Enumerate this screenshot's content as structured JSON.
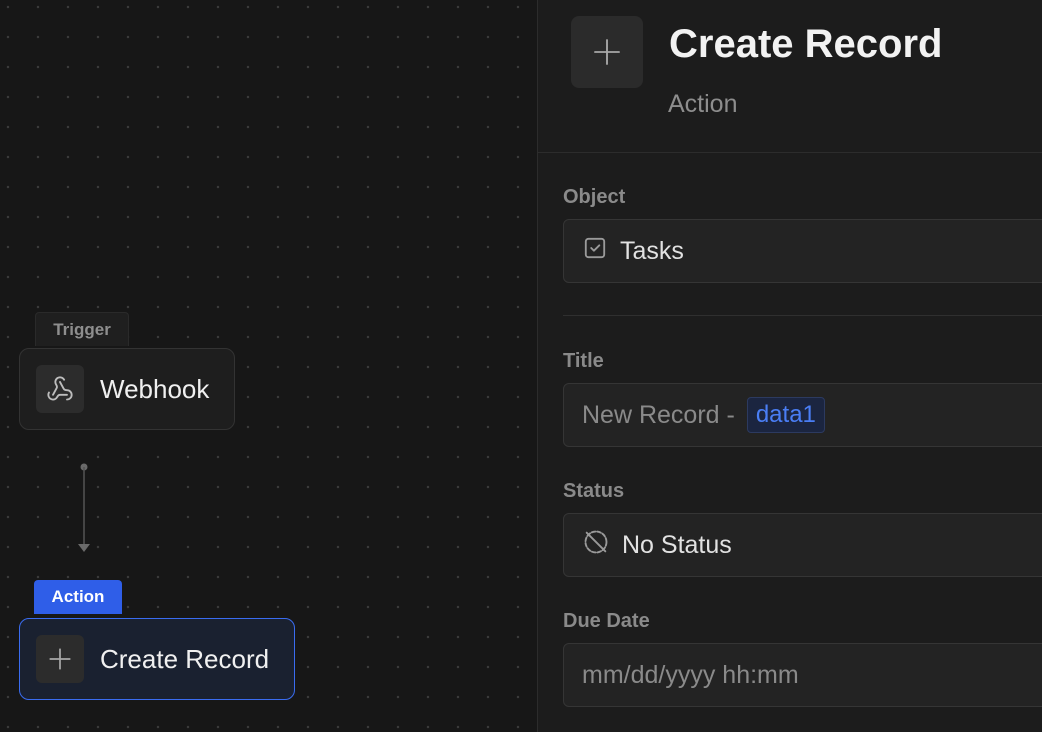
{
  "canvas": {
    "trigger_node": {
      "tag": "Trigger",
      "label": "Webhook",
      "icon": "webhook-icon"
    },
    "action_node": {
      "tag": "Action",
      "label": "Create Record",
      "icon": "plus-icon"
    }
  },
  "panel": {
    "header": {
      "icon": "plus-icon",
      "title": "Create Record",
      "subtitle": "Action"
    },
    "fields": {
      "object": {
        "label": "Object",
        "value": "Tasks",
        "icon": "checkbox-icon"
      },
      "title": {
        "label": "Title",
        "value_prefix": "New Record -",
        "token": "data1"
      },
      "status": {
        "label": "Status",
        "value": "No Status",
        "icon": "no-status-icon"
      },
      "due_date": {
        "label": "Due Date",
        "placeholder": "mm/dd/yyyy hh:mm"
      }
    }
  },
  "colors": {
    "accent": "#2f5ee8",
    "token_text": "#4a7ef5",
    "background": "#171717"
  }
}
